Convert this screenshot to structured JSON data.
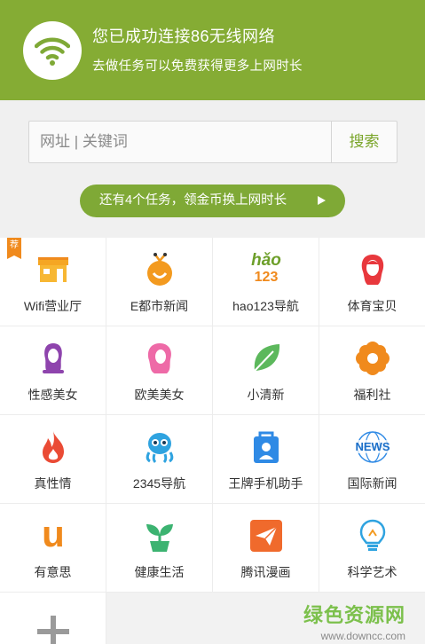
{
  "header": {
    "title": "您已成功连接86无线网络",
    "subtitle": "去做任务可以免费获得更多上网时长",
    "icon": "wifi-icon",
    "color": "#85ac34"
  },
  "search": {
    "placeholder": "网址 | 关键词",
    "button_label": "搜索"
  },
  "task_banner": {
    "text": "还有4个任务，领金币换上网时长",
    "icon": "play-arrow-icon"
  },
  "grid": {
    "recommend_badge": "荐",
    "items": [
      {
        "label": "Wifi营业厅",
        "icon": "storefront-icon"
      },
      {
        "label": "E都市新闻",
        "icon": "e-news-icon"
      },
      {
        "label": "hao123导航",
        "icon": "hao123-logo-icon",
        "logo_top": "hǎo",
        "logo_bottom": "123"
      },
      {
        "label": "体育宝贝",
        "icon": "woman-red-hair-icon"
      },
      {
        "label": "性感美女",
        "icon": "woman-purple-icon"
      },
      {
        "label": "欧美美女",
        "icon": "woman-pink-icon"
      },
      {
        "label": "小清新",
        "icon": "leaf-icon"
      },
      {
        "label": "福利社",
        "icon": "flower-icon"
      },
      {
        "label": "真性情",
        "icon": "flame-icon"
      },
      {
        "label": "2345导航",
        "icon": "octopus-icon"
      },
      {
        "label": "王牌手机助手",
        "icon": "shopping-bag-icon"
      },
      {
        "label": "国际新闻",
        "icon": "news-globe-icon",
        "logo_text": "NEWS"
      },
      {
        "label": "有意思",
        "icon": "letter-u-icon",
        "logo_text": "u"
      },
      {
        "label": "健康生活",
        "icon": "sprout-icon"
      },
      {
        "label": "腾讯漫画",
        "icon": "paper-plane-icon"
      },
      {
        "label": "科学艺术",
        "icon": "lightbulb-icon"
      }
    ],
    "add_icon": "plus-icon"
  },
  "watermark": {
    "title": "绿色资源网",
    "url": "www.downcc.com"
  }
}
